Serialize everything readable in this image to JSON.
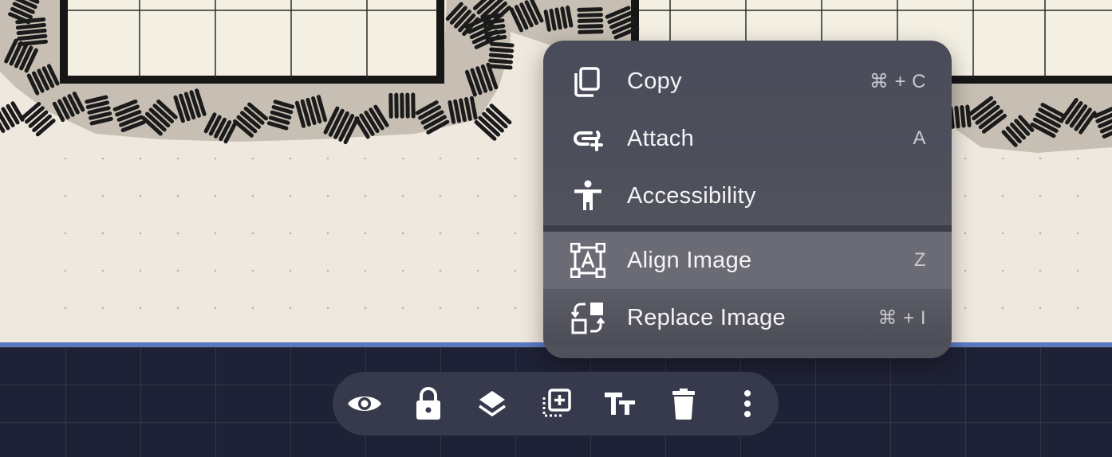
{
  "context_menu": {
    "items": [
      {
        "label": "Copy",
        "shortcut": "⌘ + C",
        "icon": "copy-icon"
      },
      {
        "label": "Attach",
        "shortcut": "A",
        "icon": "attach-link-icon"
      },
      {
        "label": "Accessibility",
        "shortcut": "",
        "icon": "accessibility-icon"
      },
      {
        "label": "Align Image",
        "shortcut": "Z",
        "icon": "align-image-icon",
        "highlighted": true
      },
      {
        "label": "Replace Image",
        "shortcut": "⌘ + I",
        "icon": "replace-image-icon"
      }
    ]
  },
  "toolbar": {
    "buttons": [
      {
        "icon": "eye-icon",
        "action": "visibility"
      },
      {
        "icon": "lock-icon",
        "action": "lock"
      },
      {
        "icon": "layers-icon",
        "action": "layers"
      },
      {
        "icon": "add-frame-icon",
        "action": "add"
      },
      {
        "icon": "text-size-icon",
        "action": "text"
      },
      {
        "icon": "trash-icon",
        "action": "delete"
      },
      {
        "icon": "more-vertical-icon",
        "action": "more"
      }
    ]
  },
  "colors": {
    "canvas": "#efe8df",
    "accent_line": "#5b79c2",
    "panel": "#1f2236",
    "menu": "#4d4f5b",
    "menu_highlight": "#6a6b74",
    "toolbar": "#363a4c"
  }
}
